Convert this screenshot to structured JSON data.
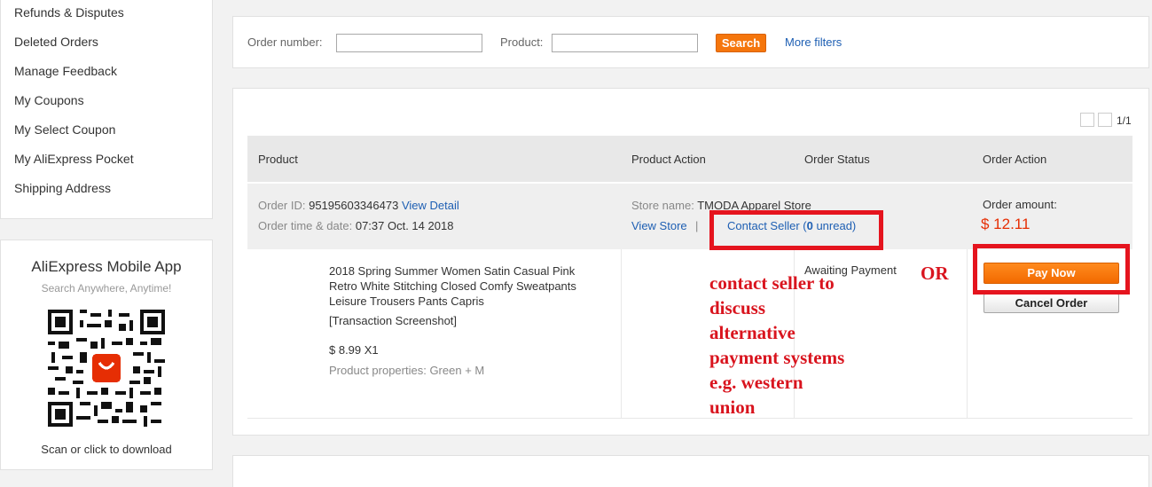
{
  "sidebar": {
    "items": [
      {
        "label": "Refunds & Disputes"
      },
      {
        "label": "Deleted Orders"
      },
      {
        "label": "Manage Feedback"
      },
      {
        "label": "My Coupons"
      },
      {
        "label": "My Select Coupon"
      },
      {
        "label": "My AliExpress Pocket"
      },
      {
        "label": "Shipping Address"
      }
    ]
  },
  "app_promo": {
    "title": "AliExpress Mobile App",
    "subtitle": "Search Anywhere, Anytime!",
    "download": "Scan or click to download"
  },
  "filters": {
    "order_number_label": "Order number:",
    "order_number_value": "",
    "product_label": "Product:",
    "product_value": "",
    "search_label": "Search",
    "more_filters_label": "More filters"
  },
  "pagination": {
    "text": "1/1"
  },
  "table": {
    "headers": [
      "Product",
      "Product Action",
      "Order Status",
      "Order Action"
    ]
  },
  "order": {
    "id_label": "Order ID:",
    "id_value": "95195603346473",
    "view_detail": "View Detail",
    "time_label": "Order time & date:",
    "time_value": "07:37 Oct. 14 2018",
    "store_label": "Store name:",
    "store_value": "TMODA Apparel Store",
    "view_store": "View Store",
    "separator": "|",
    "contact_prefix": "Contact Seller (",
    "contact_count": "0",
    "contact_suffix": " unread)",
    "amount_label": "Order amount:",
    "amount_value": "$ 12.11",
    "product_title": "2018 Spring Summer Women Satin Casual Pink Retro White Stitching Closed Comfy Sweatpants Leisure Trousers Pants Capris",
    "snapshot": "[Transaction Screenshot]",
    "price": "$ 8.99 X1",
    "properties": "Product properties: Green + M",
    "status": "Awaiting Payment",
    "pay_now": "Pay Now",
    "cancel_order": "Cancel Order"
  },
  "annotations": {
    "or_text": "OR",
    "note_lines": [
      "contact seller to",
      "discuss",
      "alternative",
      "payment systems",
      "e.g. western",
      "union"
    ],
    "color": "#e5141e"
  },
  "colors": {
    "accent_orange": "#f5760c",
    "link_blue": "#1e5fb3",
    "price_red": "#e62e04"
  }
}
